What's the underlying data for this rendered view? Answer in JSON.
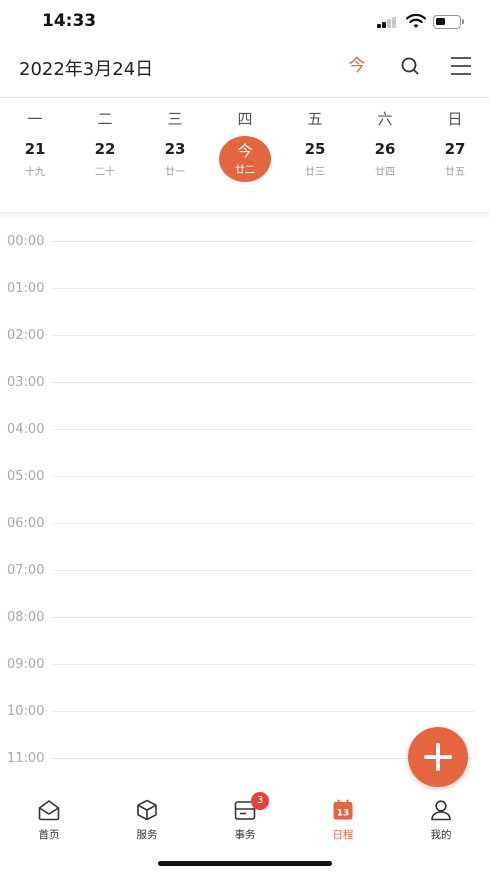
{
  "status_bar": {
    "time": "14:33"
  },
  "header": {
    "date": "2022年3月24日",
    "today_label": "今"
  },
  "week": {
    "weekdays": [
      "一",
      "二",
      "三",
      "四",
      "五",
      "六",
      "日"
    ],
    "days": [
      {
        "num": "21",
        "lunar": "十九",
        "today": false
      },
      {
        "num": "22",
        "lunar": "二十",
        "today": false
      },
      {
        "num": "23",
        "lunar": "廿一",
        "today": false
      },
      {
        "num": "今",
        "lunar": "廿二",
        "today": true
      },
      {
        "num": "25",
        "lunar": "廿三",
        "today": false
      },
      {
        "num": "26",
        "lunar": "廿四",
        "today": false
      },
      {
        "num": "27",
        "lunar": "廿五",
        "today": false
      }
    ]
  },
  "timeline": {
    "hours": [
      "00:00",
      "01:00",
      "02:00",
      "03:00",
      "04:00",
      "05:00",
      "06:00",
      "07:00",
      "08:00",
      "09:00",
      "10:00",
      "11:00"
    ]
  },
  "tabs": [
    {
      "label": "首页",
      "icon": "home-icon",
      "active": false
    },
    {
      "label": "服务",
      "icon": "cube-icon",
      "active": false
    },
    {
      "label": "事务",
      "icon": "inbox-icon",
      "active": false,
      "badge": "3"
    },
    {
      "label": "日程",
      "icon": "calendar-icon",
      "active": true
    },
    {
      "label": "我的",
      "icon": "user-icon",
      "active": false
    }
  ],
  "colors": {
    "accent": "#e4653f",
    "badge": "#e5403a"
  }
}
